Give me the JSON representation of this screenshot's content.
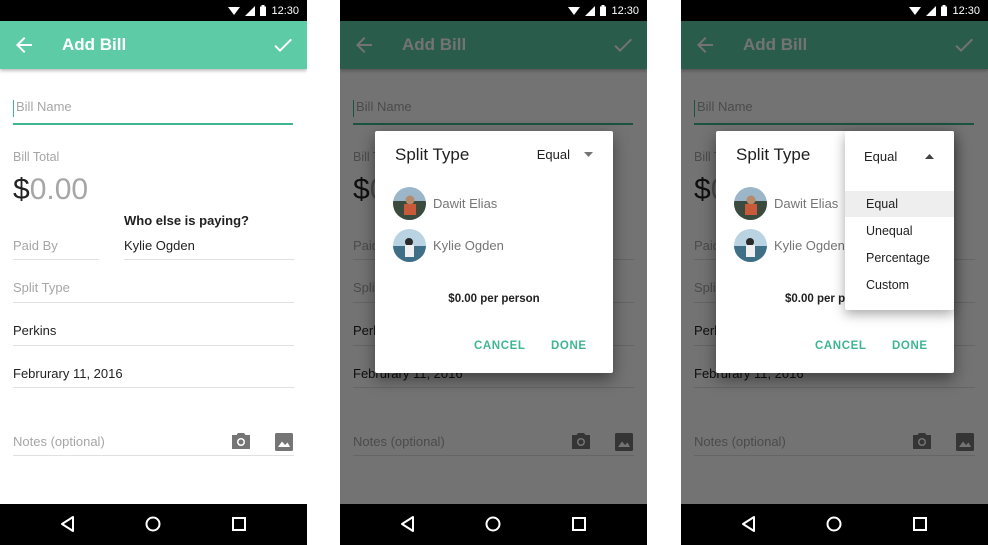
{
  "status_bar": {
    "time": "12:30"
  },
  "toolbar": {
    "title": "Add Bill"
  },
  "form": {
    "bill_name_placeholder": "Bill Name",
    "bill_total_label": "Bill Total",
    "currency_symbol": "$",
    "amount_placeholder": "0.00",
    "who_else_label": "Who else is paying?",
    "paid_by_placeholder": "Paid By",
    "co_payer": "Kylie Ogden",
    "split_type_placeholder": "Split Type",
    "merchant": "Perkins",
    "date": "Februrary 11, 2016",
    "notes_placeholder": "Notes (optional)"
  },
  "dialog": {
    "title": "Split Type",
    "selected_split": "Equal",
    "people": [
      {
        "name": "Dawit Elias"
      },
      {
        "name": "Kylie Ogden"
      }
    ],
    "per_person_text": "$0.00 per person",
    "per_person_partial": "$0.00 per p",
    "cancel_label": "CANCEL",
    "done_label": "DONE"
  },
  "split_menu": {
    "options": [
      "Equal",
      "Unequal",
      "Percentage",
      "Custom"
    ],
    "selected_index": 0
  },
  "colors": {
    "primary": "#5dcca6",
    "accent": "#3fb692",
    "status_bar": "#000000",
    "hint": "#a6a6a6"
  },
  "icons": [
    "back-arrow-icon",
    "check-icon",
    "wifi-icon",
    "signal-icon",
    "battery-icon",
    "camera-icon",
    "image-icon",
    "nav-back-icon",
    "nav-home-icon",
    "nav-recents-icon",
    "dropdown-arrow-icon",
    "dropdown-up-arrow-icon"
  ]
}
